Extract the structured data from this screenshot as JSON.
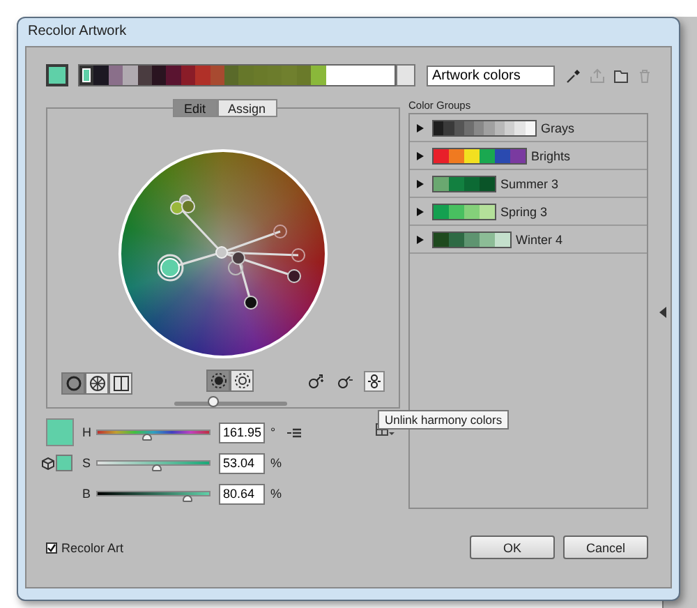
{
  "window": {
    "title": "Recolor Artwork"
  },
  "toolbar": {
    "swatches": [
      {
        "color": "#5fd0a8",
        "selected": true
      },
      {
        "color": "#1c1822",
        "selected": false
      },
      {
        "color": "#8a6f8a",
        "selected": false
      },
      {
        "color": "#b0aab0",
        "selected": false
      },
      {
        "color": "#4a3c40",
        "selected": false
      },
      {
        "color": "#2a1420",
        "selected": false
      },
      {
        "color": "#5a1430",
        "selected": false
      },
      {
        "color": "#8a1c28",
        "selected": false
      },
      {
        "color": "#b03028",
        "selected": false
      },
      {
        "color": "#a84a30",
        "selected": false
      },
      {
        "color": "#5a6a2a",
        "selected": false
      },
      {
        "color": "#66772a",
        "selected": false
      },
      {
        "color": "#6a7a2a",
        "selected": false
      },
      {
        "color": "#6c7c2c",
        "selected": false
      },
      {
        "color": "#70802e",
        "selected": false
      },
      {
        "color": "#6a7a2a",
        "selected": false
      },
      {
        "color": "#8ab83a",
        "selected": false
      }
    ],
    "name_field": {
      "value": "Artwork colors"
    }
  },
  "tabs": [
    {
      "label": "Edit",
      "selected": true
    },
    {
      "label": "Assign",
      "selected": false
    }
  ],
  "wheel_modes": [
    {
      "kind": "smooth",
      "selected": true
    },
    {
      "kind": "segmented",
      "selected": false
    },
    {
      "kind": "bars",
      "selected": false
    }
  ],
  "display_toggles": [
    {
      "kind": "saturation",
      "selected": true
    },
    {
      "kind": "brightness",
      "selected": false
    }
  ],
  "wheel_slider": {
    "level": 0.35
  },
  "sliders": [
    {
      "label": "H",
      "value": "161.95",
      "unit": "°",
      "level": 0.44,
      "kind": "hue"
    },
    {
      "label": "S",
      "value": "53.04",
      "unit": "%",
      "level": 0.52,
      "kind": "saturation"
    },
    {
      "label": "B",
      "value": "80.64",
      "unit": "%",
      "level": 0.8,
      "kind": "brightness"
    }
  ],
  "tooltip": "Unlink harmony colors",
  "color_groups": {
    "title": "Color Groups",
    "items": [
      {
        "name": "Grays",
        "expanded": false,
        "colors": [
          {
            "color": "#1e1e1e"
          },
          {
            "color": "#3a3a3a"
          },
          {
            "color": "#555555"
          },
          {
            "color": "#6e6e6e"
          },
          {
            "color": "#888888"
          },
          {
            "color": "#a0a0a0"
          },
          {
            "color": "#b8b8b8"
          },
          {
            "color": "#cfcfcf"
          },
          {
            "color": "#e4e4e4"
          },
          {
            "color": "#f6f6f6"
          }
        ]
      },
      {
        "name": "Brights",
        "expanded": false,
        "colors": [
          {
            "color": "#e8202a"
          },
          {
            "color": "#f07a20"
          },
          {
            "color": "#f2e020"
          },
          {
            "color": "#1aa850"
          },
          {
            "color": "#2a4ab0"
          },
          {
            "color": "#7a3aa0"
          }
        ]
      },
      {
        "name": "Summer 3",
        "expanded": false,
        "colors": [
          {
            "color": "#6aa870"
          },
          {
            "color": "#128040"
          },
          {
            "color": "#0c6a34"
          },
          {
            "color": "#0a5428"
          }
        ]
      },
      {
        "name": "Spring 3",
        "expanded": false,
        "colors": [
          {
            "color": "#14a050"
          },
          {
            "color": "#48c060"
          },
          {
            "color": "#84d07a"
          },
          {
            "color": "#b4e09a"
          }
        ]
      },
      {
        "name": "Winter 4",
        "expanded": false,
        "colors": [
          {
            "color": "#1e4a1e"
          },
          {
            "color": "#2e6a44"
          },
          {
            "color": "#5e9470"
          },
          {
            "color": "#8cbc96"
          },
          {
            "color": "#c4e0cc"
          }
        ]
      }
    ]
  },
  "recolor_art": {
    "label": "Recolor Art",
    "checked": true
  },
  "buttons": [
    "OK",
    "Cancel"
  ]
}
